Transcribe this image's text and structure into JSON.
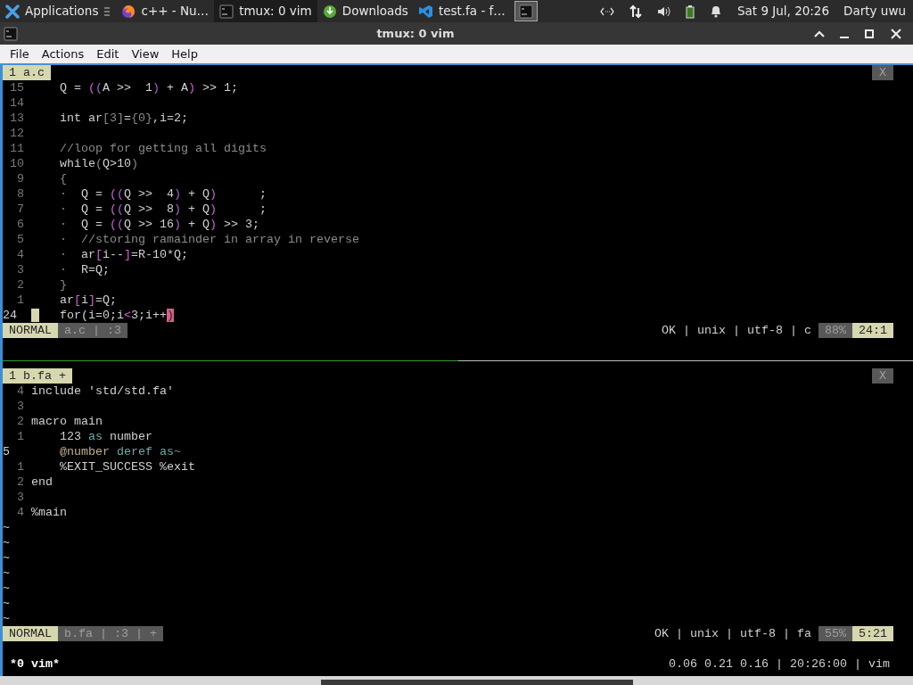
{
  "taskbar": {
    "apps_label": "Applications",
    "tasks": [
      {
        "kind": "firefox",
        "label": "c++ - Nu…",
        "selected": false
      },
      {
        "kind": "terminal",
        "label": "tmux: 0 vim",
        "selected": true
      },
      {
        "kind": "download",
        "label": "Downloads",
        "selected": false
      },
      {
        "kind": "vscode",
        "label": "test.fa - f…",
        "selected": false
      },
      {
        "kind": "terminal-square",
        "selected": false
      }
    ],
    "clock": "Sat  9 Jul, 20:26",
    "user": "Darty uwu"
  },
  "window": {
    "title": "tmux: 0 vim"
  },
  "menu": [
    "File",
    "Actions",
    "Edit",
    "View",
    "Help"
  ],
  "panes": [
    {
      "tab": "1 a.c",
      "close": "X",
      "lines": [
        {
          "number": "15",
          "current": false,
          "segments": [
            {
              "text": "Q = ",
              "kind": "plain"
            },
            {
              "text": "(",
              "kind": "paren1"
            },
            {
              "text": "(",
              "kind": "paren2"
            },
            {
              "text": "A >>  1",
              "kind": "plain"
            },
            {
              "text": ")",
              "kind": "paren2"
            },
            {
              "text": " + A",
              "kind": "plain"
            },
            {
              "text": ")",
              "kind": "paren1"
            },
            {
              "text": " >> 1;",
              "kind": "plain"
            }
          ]
        },
        {
          "number": "14",
          "current": false
        },
        {
          "number": "13",
          "current": false,
          "segments": [
            {
              "text": "int ar",
              "kind": "plain"
            },
            {
              "text": "[3]",
              "kind": "dim"
            },
            {
              "text": "=",
              "kind": "plain"
            },
            {
              "text": "{0}",
              "kind": "dim"
            },
            {
              "text": ",i=2;",
              "kind": "plain"
            }
          ]
        },
        {
          "number": "12",
          "current": false
        },
        {
          "number": "11",
          "current": false,
          "segments": [
            {
              "text": "//loop for getting all digits",
              "kind": "comment"
            }
          ]
        },
        {
          "number": "10",
          "current": false,
          "segments": [
            {
              "text": "while",
              "kind": "plain"
            },
            {
              "text": "(",
              "kind": "dim"
            },
            {
              "text": "Q>10",
              "kind": "plain"
            },
            {
              "text": ")",
              "kind": "dim"
            }
          ]
        },
        {
          "number": "9",
          "current": false,
          "segments": [
            {
              "text": "{",
              "kind": "dim"
            }
          ]
        },
        {
          "number": "8",
          "current": false,
          "segments": [
            {
              "text": "·",
              "kind": "dim"
            },
            {
              "text": "  Q = ",
              "kind": "plain"
            },
            {
              "text": "(",
              "kind": "paren1"
            },
            {
              "text": "(",
              "kind": "paren2"
            },
            {
              "text": "Q >>  4",
              "kind": "plain"
            },
            {
              "text": ")",
              "kind": "paren2"
            },
            {
              "text": " + Q",
              "kind": "plain"
            },
            {
              "text": ")",
              "kind": "paren1"
            },
            {
              "text": "      ;",
              "kind": "plain"
            }
          ]
        },
        {
          "number": "7",
          "current": false,
          "segments": [
            {
              "text": "·",
              "kind": "dim"
            },
            {
              "text": "  Q = ",
              "kind": "plain"
            },
            {
              "text": "(",
              "kind": "paren1"
            },
            {
              "text": "(",
              "kind": "paren2"
            },
            {
              "text": "Q >>  8",
              "kind": "plain"
            },
            {
              "text": ")",
              "kind": "paren2"
            },
            {
              "text": " + Q",
              "kind": "plain"
            },
            {
              "text": ")",
              "kind": "paren1"
            },
            {
              "text": "      ;",
              "kind": "plain"
            }
          ]
        },
        {
          "number": "6",
          "current": false,
          "segments": [
            {
              "text": "·",
              "kind": "dim"
            },
            {
              "text": "  Q = ",
              "kind": "plain"
            },
            {
              "text": "(",
              "kind": "paren1"
            },
            {
              "text": "(",
              "kind": "paren2"
            },
            {
              "text": "Q >> 16",
              "kind": "plain"
            },
            {
              "text": ")",
              "kind": "paren2"
            },
            {
              "text": " + Q",
              "kind": "plain"
            },
            {
              "text": ")",
              "kind": "paren1"
            },
            {
              "text": " >> 3;",
              "kind": "plain"
            }
          ]
        },
        {
          "number": "5",
          "current": false,
          "segments": [
            {
              "text": "·",
              "kind": "dim"
            },
            {
              "text": "  //storing ramainder in array in reverse",
              "kind": "comment"
            }
          ]
        },
        {
          "number": "4",
          "current": false,
          "segments": [
            {
              "text": "·",
              "kind": "dim"
            },
            {
              "text": "  ar",
              "kind": "plain"
            },
            {
              "text": "[",
              "kind": "paren1"
            },
            {
              "text": "i--",
              "kind": "plain"
            },
            {
              "text": "]",
              "kind": "paren1"
            },
            {
              "text": "=R-10*Q;",
              "kind": "plain"
            }
          ]
        },
        {
          "number": "3",
          "current": false,
          "segments": [
            {
              "text": "·",
              "kind": "dim"
            },
            {
              "text": "  R=Q;",
              "kind": "plain"
            }
          ]
        },
        {
          "number": "2",
          "current": false,
          "segments": [
            {
              "text": "}",
              "kind": "dim"
            }
          ]
        },
        {
          "number": "1",
          "current": false,
          "segments": [
            {
              "text": "ar",
              "kind": "plain"
            },
            {
              "text": "[",
              "kind": "paren1"
            },
            {
              "text": "i",
              "kind": "plain"
            },
            {
              "text": "]",
              "kind": "paren1"
            },
            {
              "text": "=Q;",
              "kind": "plain"
            }
          ]
        },
        {
          "number": "24",
          "current": true,
          "marker": true,
          "segments": [
            {
              "text": "for(i=0;i",
              "kind": "plain"
            },
            {
              "text": "<",
              "kind": "paren1"
            },
            {
              "text": "3;i++",
              "kind": "plain"
            },
            {
              "text": ")",
              "kind": "cursor"
            }
          ]
        }
      ],
      "status": {
        "mode": "NORMAL",
        "file": "a.c | :3",
        "info": "OK | unix | utf-8 | c",
        "percent": "88%",
        "position": "24:1"
      }
    },
    {
      "tab": "1 b.fa +",
      "close": "X",
      "lines": [
        {
          "number": "4",
          "current": false,
          "segments": [
            {
              "text": "include 'std/std.fa'",
              "kind": "plain"
            }
          ]
        },
        {
          "number": "3",
          "current": false
        },
        {
          "number": "2",
          "current": false,
          "segments": [
            {
              "text": "macro main",
              "kind": "plain"
            }
          ]
        },
        {
          "number": "1",
          "current": false,
          "segments": [
            {
              "text": "    123 ",
              "kind": "plain"
            },
            {
              "text": "as",
              "kind": "keyword"
            },
            {
              "text": " number",
              "kind": "plain"
            }
          ]
        },
        {
          "number": "5",
          "current": true,
          "segments": [
            {
              "text": "    @number",
              "kind": "macro"
            },
            {
              "text": " deref as",
              "kind": "keyword"
            },
            {
              "text": "~",
              "kind": "dim"
            }
          ]
        },
        {
          "number": "1",
          "current": false,
          "segments": [
            {
              "text": "    %EXIT_SUCCESS %exit",
              "kind": "plain"
            }
          ]
        },
        {
          "number": "2",
          "current": false,
          "segments": [
            {
              "text": "end",
              "kind": "plain"
            }
          ]
        },
        {
          "number": "3",
          "current": false
        },
        {
          "number": "4",
          "current": false,
          "segments": [
            {
              "text": "%main",
              "kind": "plain"
            }
          ]
        }
      ],
      "filler": [
        "~",
        "~",
        "~",
        "~",
        "~",
        "~",
        "~"
      ],
      "status": {
        "mode": "NORMAL",
        "file": "b.fa | :3 | +",
        "info": "OK | unix | utf-8 | fa",
        "percent": "55%",
        "position": "5:21"
      }
    }
  ],
  "tmux_status": {
    "window": "*0 vim*",
    "right": "0.06 0.21 0.16 | 20:26:00 | vim"
  }
}
